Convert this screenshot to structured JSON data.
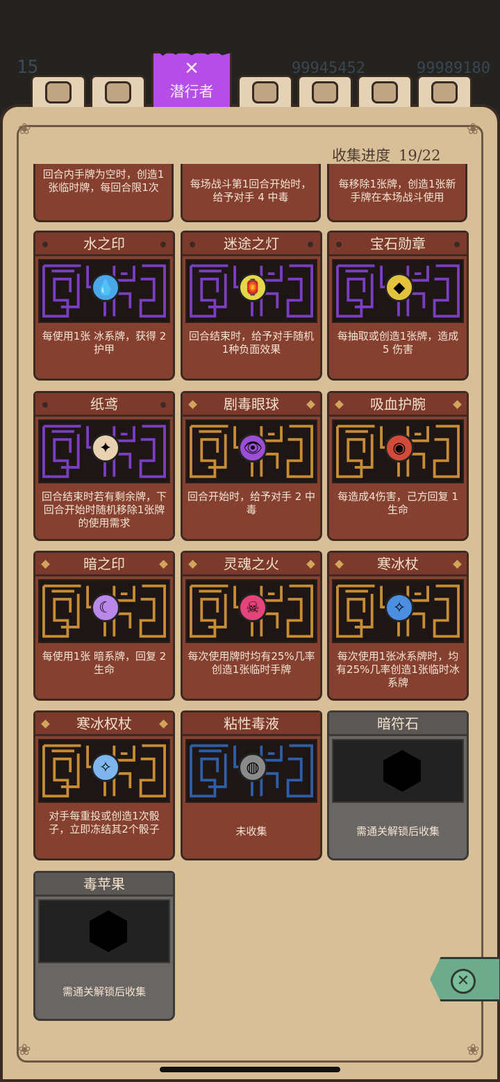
{
  "header": {
    "level": "15",
    "currency1": "99945452",
    "currency2": "99989180"
  },
  "tabs": [
    {
      "name": "tab-gear",
      "icon": "gear-icon"
    },
    {
      "name": "tab-shield",
      "icon": "shield-icon"
    },
    {
      "name": "tab-active",
      "label": "潜行者",
      "icon": "crossed-blades-icon"
    },
    {
      "name": "tab-wind",
      "icon": "wind-icon"
    },
    {
      "name": "tab-triangle",
      "icon": "triangle-icon"
    },
    {
      "name": "tab-eye",
      "icon": "eye-icon"
    },
    {
      "name": "tab-bricks",
      "icon": "bricks-icon"
    }
  ],
  "progress": {
    "label": "收集进度",
    "value": "19/22"
  },
  "partial_cards": [
    {
      "desc": "回合内手牌为空时，创造1张临时牌，每回合限1次"
    },
    {
      "desc": "每场战斗第1回合开始时，给予对手 4 中毒"
    },
    {
      "desc": "每移除1张牌，创造1张新手牌在本场战斗使用"
    }
  ],
  "cards": [
    {
      "title": "水之印",
      "desc": "每使用1张 冰系牌，获得 2 护甲",
      "color": "#7a3fc0",
      "marker": "dot",
      "icon": "💧",
      "iconBg": "#4ba8e8"
    },
    {
      "title": "迷途之灯",
      "desc": "回合结束时，给予对手随机1种负面效果",
      "color": "#7a3fc0",
      "marker": "dot",
      "icon": "🏮",
      "iconBg": "#e4d84a"
    },
    {
      "title": "宝石勋章",
      "desc": "每抽取或创造1张牌，造成 5 伤害",
      "color": "#7a3fc0",
      "marker": "dot",
      "icon": "◆",
      "iconBg": "#e3c23d"
    },
    {
      "title": "纸鸢",
      "desc": "回合结束时若有剩余牌，下回合开始时随机移除1张牌的使用需求",
      "color": "#7a3fc0",
      "marker": "dot",
      "icon": "✦",
      "iconBg": "#e8d2b0"
    },
    {
      "title": "剧毒眼球",
      "desc": "回合开始时，给予对手 2 中毒",
      "color": "#c88c34",
      "marker": "diamond",
      "icon": "👁",
      "iconBg": "#9b4fd4"
    },
    {
      "title": "吸血护腕",
      "desc": "每造成4伤害，己方回复 1 生命",
      "color": "#c88c34",
      "marker": "diamond",
      "icon": "◉",
      "iconBg": "#d24a3a"
    },
    {
      "title": "暗之印",
      "desc": "每使用1张 暗系牌，回复 2 生命",
      "color": "#c88c34",
      "marker": "diamond",
      "icon": "☾",
      "iconBg": "#b988e8"
    },
    {
      "title": "灵魂之火",
      "desc": "每次使用牌时均有25%几率创造1张临时手牌",
      "color": "#c88c34",
      "marker": "diamond",
      "icon": "☠",
      "iconBg": "#e3447a"
    },
    {
      "title": "寒冰杖",
      "desc": "每次使用1张冰系牌时，均有25%几率创造1张临时冰系牌",
      "color": "#c88c34",
      "marker": "diamond",
      "icon": "✧",
      "iconBg": "#4c8fe0"
    },
    {
      "title": "寒冰权杖",
      "desc": "对手每重投或创造1次骰子，立即冻结其2个骰子",
      "color": "#c88c34",
      "marker": "diamond",
      "icon": "✧",
      "iconBg": "#7fb6ee"
    },
    {
      "title": "粘性毒液",
      "desc": "未收集",
      "color": "#2f5ea8",
      "marker": "none",
      "icon": "◍",
      "iconBg": "#8a8a8a"
    },
    {
      "title": "暗符石",
      "desc": "需通关解锁后收集",
      "locked": true
    },
    {
      "title": "毒苹果",
      "desc": "需通关解锁后收集",
      "locked": true
    }
  ]
}
